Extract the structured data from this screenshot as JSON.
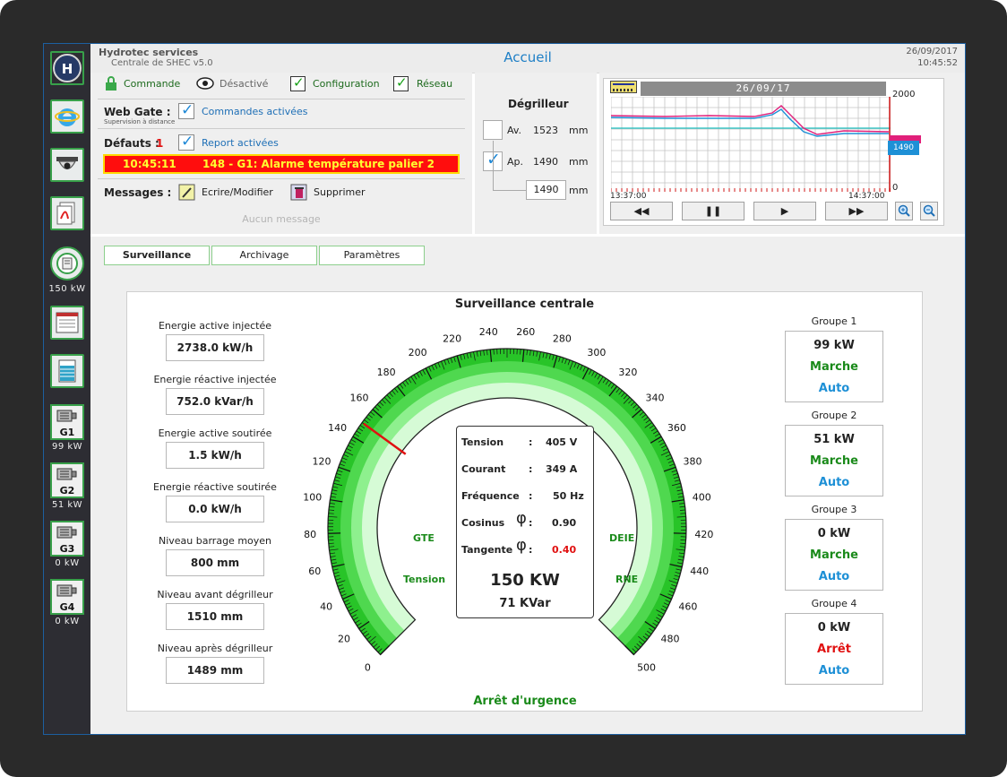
{
  "header": {
    "company": "Hydrotec services",
    "subtitle": "Centrale de SHEC v5.0",
    "title": "Accueil",
    "date": "26/09/2017",
    "time": "10:45:52"
  },
  "sidebar": {
    "power_caption": "150 kW",
    "generators": [
      {
        "label": "G1",
        "caption": "99 kW"
      },
      {
        "label": "G2",
        "caption": "51 kW"
      },
      {
        "label": "G3",
        "caption": "0 kW"
      },
      {
        "label": "G4",
        "caption": "0 kW"
      }
    ]
  },
  "toolbar": {
    "commande": "Commande",
    "desactive": "Désactivé",
    "configuration": "Configuration",
    "reseau": "Réseau"
  },
  "webgate": {
    "label": "Web Gate :",
    "sub": "Supervision à distance",
    "value": "Commandes activées"
  },
  "defauts": {
    "label": "Défauts :",
    "count": "1",
    "report": "Report activées",
    "alarm_time": "10:45:11",
    "alarm_text": "148 - G1: Alarme température palier 2"
  },
  "messages": {
    "label": "Messages :",
    "edit": "Ecrire/Modifier",
    "delete": "Supprimer",
    "empty": "Aucun message"
  },
  "degrilleur": {
    "title": "Dégrilleur",
    "av_label": "Av.",
    "av_value": "1523",
    "ap_label": "Ap.",
    "ap_value": "1490",
    "unit": "mm",
    "setpoint": "1490"
  },
  "trend": {
    "date": "26/09/17",
    "ymax": "2000",
    "ymin": "0",
    "t_start": "13:37:00",
    "t_end": "14:37:00",
    "marker": "1490",
    "buttons": {
      "rewind": "◀◀",
      "pause": "❚❚",
      "play": "▶",
      "forward": "▶▶"
    }
  },
  "tabs": [
    "Surveillance",
    "Archivage",
    "Paramètres"
  ],
  "surveillance": {
    "title": "Surveillance centrale",
    "energy": [
      {
        "label": "Energie active injectée",
        "value": "2738.0 kW/h"
      },
      {
        "label": "Energie réactive injectée",
        "value": "752.0 kVar/h"
      },
      {
        "label": "Energie active soutirée",
        "value": "1.5 kW/h"
      },
      {
        "label": "Energie réactive soutirée",
        "value": "0.0 kW/h"
      },
      {
        "label": "Niveau barrage moyen",
        "value": "800 mm"
      },
      {
        "label": "Niveau avant dégrilleur",
        "value": "1510 mm"
      },
      {
        "label": "Niveau après dégrilleur",
        "value": "1489 mm"
      }
    ],
    "gauge": {
      "min": 0,
      "max": 500,
      "value": 150,
      "ticks": [
        "0",
        "20",
        "40",
        "60",
        "80",
        "100",
        "120",
        "140",
        "160",
        "180",
        "200",
        "220",
        "240",
        "260",
        "280",
        "300",
        "320",
        "340",
        "360",
        "380",
        "400",
        "420",
        "440",
        "460",
        "480",
        "500"
      ],
      "left_top": "GTE",
      "left_bottom": "Tension",
      "right_top": "DEIE",
      "right_bottom": "RNE",
      "emergency": "Arrêt d'urgence"
    },
    "readings": {
      "tension_label": "Tension",
      "tension_value": "405 V",
      "courant_label": "Courant",
      "courant_value": "349 A",
      "freq_label": "Fréquence",
      "freq_value": "50 Hz",
      "cos_label": "Cosinus",
      "cos_value": "0.90",
      "tan_label": "Tangente",
      "tan_value": "0.40",
      "phi": "φ",
      "colon": ":",
      "power": "150 KW",
      "reactive": "71 KVar"
    },
    "groups": [
      {
        "name": "Groupe 1",
        "power": "99 kW",
        "state": "Marche",
        "mode": "Auto",
        "state_color": "#1a8a1a"
      },
      {
        "name": "Groupe 2",
        "power": "51 kW",
        "state": "Marche",
        "mode": "Auto",
        "state_color": "#1a8a1a"
      },
      {
        "name": "Groupe 3",
        "power": "0 kW",
        "state": "Marche",
        "mode": "Auto",
        "state_color": "#1a8a1a"
      },
      {
        "name": "Groupe 4",
        "power": "0 kW",
        "state": "Arrêt",
        "mode": "Auto",
        "state_color": "#e01010"
      }
    ]
  },
  "colors": {
    "accent": "#1e90d6",
    "ok": "#1a8a1a",
    "alarm": "#ff0000",
    "gauge": "#22c422"
  }
}
